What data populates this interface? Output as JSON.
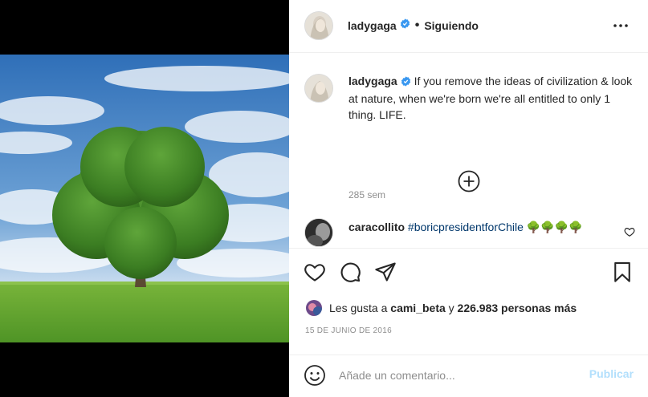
{
  "post": {
    "author": "ladygaga",
    "follow_separator": "•",
    "follow_status": "Siguiendo",
    "caption": "If you remove the ideas of civilization & look at nature, when we're born we're all entitled to only 1 thing. LIFE.",
    "caption_time": "285 sem",
    "comments": [
      {
        "user": "caracollito",
        "hashtag": "#boricpresidentforChile",
        "emoji": "🌳🌳🌳🌳"
      }
    ],
    "likes": {
      "prefix": "Les gusta a",
      "first_user": "cami_beta",
      "connector": "y",
      "others": "226.983 personas más"
    },
    "date": "15 DE JUNIO DE 2016"
  },
  "add_comment": {
    "placeholder": "Añade un comentario...",
    "publish_label": "Publicar"
  },
  "colors": {
    "link": "#00376b",
    "verified": "#3897f0",
    "publish_disabled": "#b2dffc",
    "muted": "#8e8e8e"
  },
  "icons": [
    "verified-badge-icon",
    "more-options-icon",
    "add-circle-icon",
    "heart-icon",
    "comment-icon",
    "share-icon",
    "bookmark-icon",
    "emoji-icon"
  ]
}
